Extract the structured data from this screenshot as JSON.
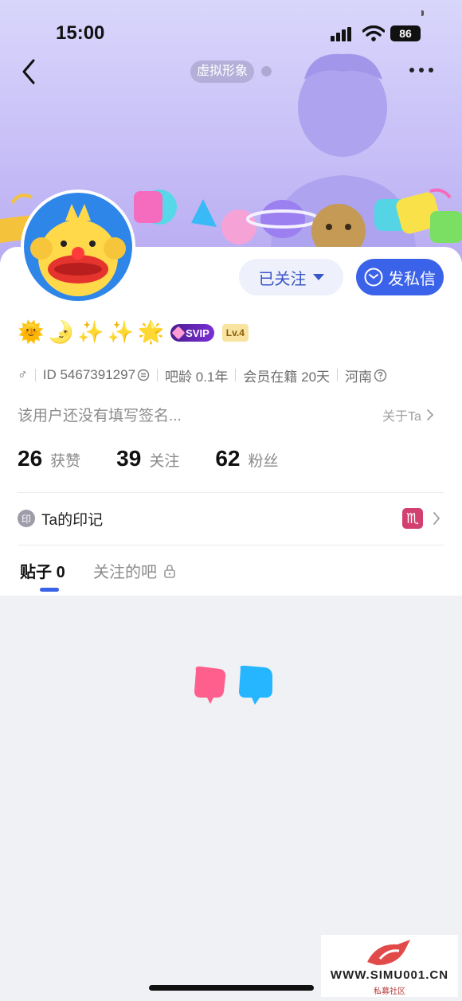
{
  "status_bar": {
    "time": "15:00",
    "battery": "86"
  },
  "header": {
    "avatar_tag": "虚拟形象"
  },
  "actions": {
    "follow_label": "已关注",
    "message_label": "发私信"
  },
  "badges": {
    "emojis": [
      "🌞",
      "🌛",
      "✨",
      "✨",
      "🌟"
    ],
    "svip": "SVIP",
    "level": "Lv.4"
  },
  "profile": {
    "gender_symbol": "♂",
    "id_text": "ID 5467391297",
    "bar_age": "吧龄 0.1年",
    "member_days": "会员在籍 20天",
    "location": "河南",
    "signature": "该用户还没有填写签名...",
    "about_label": "关于Ta"
  },
  "stats": [
    {
      "value": "26",
      "label": "获赞"
    },
    {
      "value": "39",
      "label": "关注"
    },
    {
      "value": "62",
      "label": "粉丝"
    }
  ],
  "mark": {
    "icon_text": "印",
    "label": "Ta的印记",
    "zodiac": "♏"
  },
  "tabs": {
    "posts_label": "贴子",
    "posts_count": "0",
    "followed_bars_label": "关注的吧"
  },
  "watermark": {
    "text": "WWW.SIMU001.CN",
    "sub": "私募社区"
  },
  "colors": {
    "accent": "#3b63ea",
    "banner": "#c8c0f7"
  }
}
